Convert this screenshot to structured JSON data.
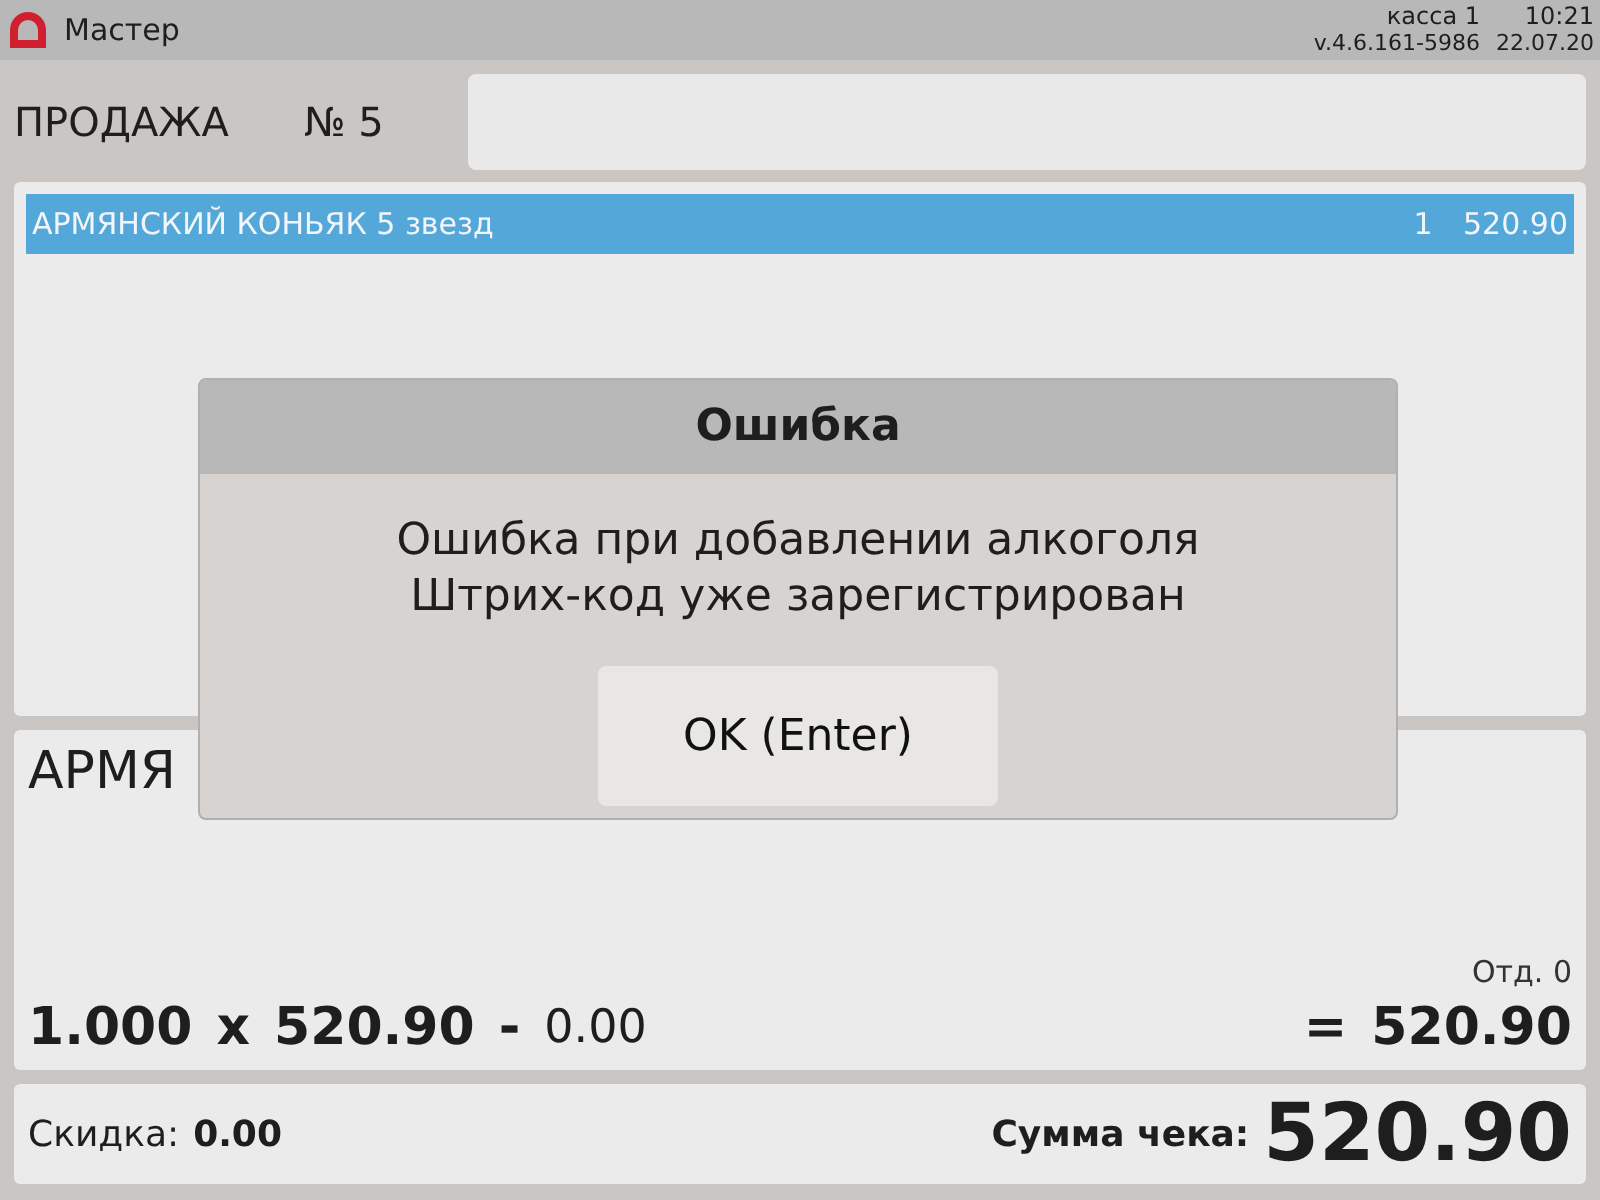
{
  "top_bar": {
    "app_name": "Мастер",
    "register": "касса 1",
    "time": "10:21",
    "version": "v.4.6.161-5986",
    "date": "22.07.20"
  },
  "header": {
    "title": "ПРОДАЖА",
    "receipt_number": "№ 5"
  },
  "receipt_items": [
    {
      "name": "АРМЯНСКИЙ КОНЬЯК 5 звезд",
      "quantity": "1",
      "price": "520.90",
      "selected": true
    }
  ],
  "item_detail": {
    "name": "АРМЯ",
    "department": "Отд. 0",
    "quantity": "1.000",
    "times": "x",
    "price": "520.90",
    "minus": "-",
    "discount": "0.00",
    "equals": "=",
    "total": "520.90"
  },
  "footer": {
    "discount_label": "Скидка:",
    "discount_value": "0.00",
    "total_label": "Сумма чека:",
    "total_value": "520.90"
  },
  "dialog": {
    "title": "Ошибка",
    "message_lines": [
      "Ошибка при добавлении алкоголя",
      "Штрих-код уже зарегистрирован"
    ],
    "button": "OK (Enter)"
  }
}
